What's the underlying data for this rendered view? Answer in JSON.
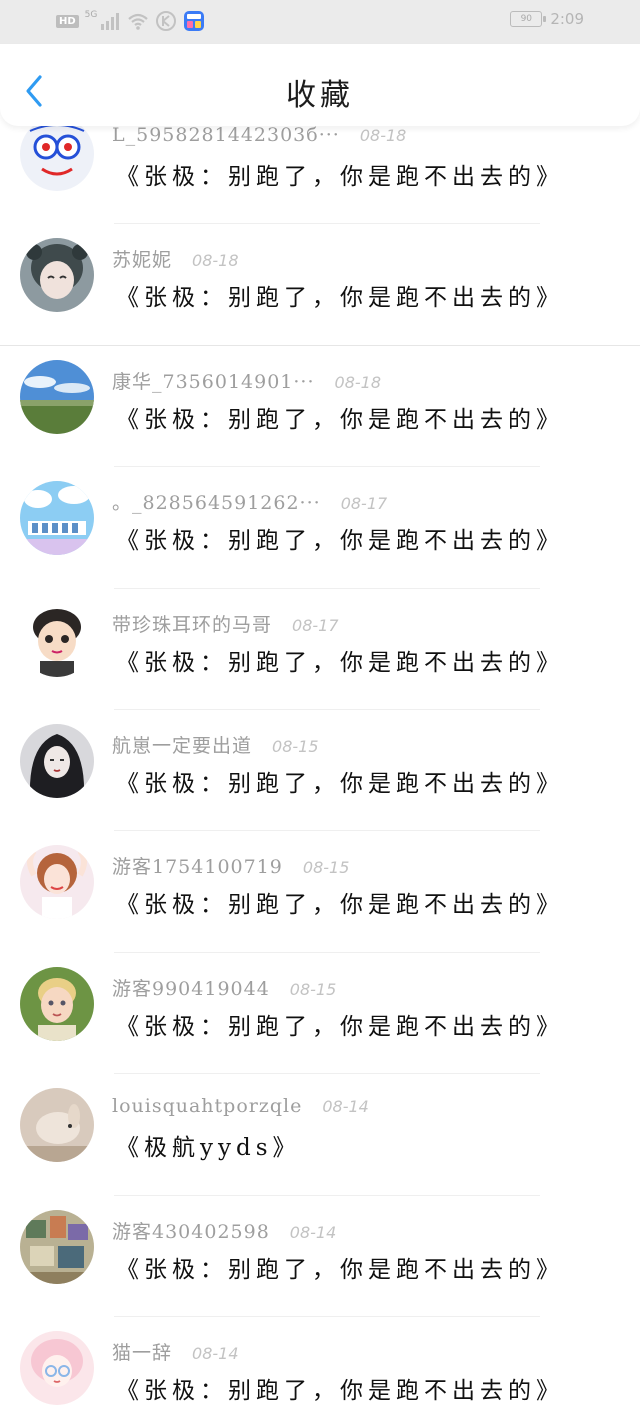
{
  "status_bar": {
    "hd": "HD",
    "network": "5G",
    "battery": "90",
    "time": "2:09"
  },
  "header": {
    "title": "收藏",
    "back_icon": "chevron-left-icon",
    "accent": "#2f9bf2"
  },
  "items": [
    {
      "username": "L_5958281442303б···",
      "date": "08-18",
      "title": "《张极：别跑了，你是跑不出去的》",
      "avatar_color": "#e9eef7"
    },
    {
      "username": "苏妮妮",
      "date": "08-18",
      "title": "《张极：别跑了，你是跑不出去的》",
      "avatar_color": "#7e8c90"
    },
    {
      "username": "康华_7356014901···",
      "date": "08-18",
      "title": "《张极：别跑了，你是跑不出去的》",
      "avatar_color": "#4a86c9"
    },
    {
      "username": "。_828564591262···",
      "date": "08-17",
      "title": "《张极：别跑了，你是跑不出去的》",
      "avatar_color": "#7cc3ef"
    },
    {
      "username": "带珍珠耳环的马哥",
      "date": "08-17",
      "title": "《张极：别跑了，你是跑不出去的》",
      "avatar_color": "#f2d9c4"
    },
    {
      "username": "航崽一定要出道",
      "date": "08-15",
      "title": "《张极：别跑了，你是跑不出去的》",
      "avatar_color": "#3a3a40"
    },
    {
      "username": "游客1754100719",
      "date": "08-15",
      "title": "《张极：别跑了，你是跑不出去的》",
      "avatar_color": "#f1d7dc"
    },
    {
      "username": "游客990419044",
      "date": "08-15",
      "title": "《张极：别跑了，你是跑不出去的》",
      "avatar_color": "#7ea05a"
    },
    {
      "username": "louisquahtporzqle",
      "date": "08-14",
      "title": "《极航yyds》",
      "avatar_color": "#c9b8a8"
    },
    {
      "username": "游客430402598",
      "date": "08-14",
      "title": "《张极：别跑了，你是跑不出去的》",
      "avatar_color": "#a6a07a"
    },
    {
      "username": "猫一辞",
      "date": "08-14",
      "title": "《张极：别跑了，你是跑不出去的》",
      "avatar_color": "#f6d6dd"
    }
  ]
}
